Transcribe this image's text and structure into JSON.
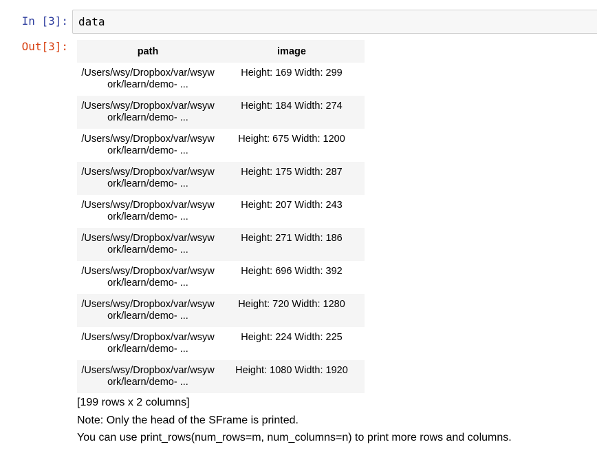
{
  "input_cell": {
    "prompt": "In [3]:",
    "code": "data"
  },
  "output_cell": {
    "prompt": "Out[3]:"
  },
  "table": {
    "headers": [
      "path",
      "image"
    ],
    "rows": [
      {
        "path": "/Users/wsy/Dropbox/var/wsywork/learn/demo- ...",
        "image": "Height: 169 Width: 299"
      },
      {
        "path": "/Users/wsy/Dropbox/var/wsywork/learn/demo- ...",
        "image": "Height: 184 Width: 274"
      },
      {
        "path": "/Users/wsy/Dropbox/var/wsywork/learn/demo- ...",
        "image": "Height: 675 Width: 1200"
      },
      {
        "path": "/Users/wsy/Dropbox/var/wsywork/learn/demo- ...",
        "image": "Height: 175 Width: 287"
      },
      {
        "path": "/Users/wsy/Dropbox/var/wsywork/learn/demo- ...",
        "image": "Height: 207 Width: 243"
      },
      {
        "path": "/Users/wsy/Dropbox/var/wsywork/learn/demo- ...",
        "image": "Height: 271 Width: 186"
      },
      {
        "path": "/Users/wsy/Dropbox/var/wsywork/learn/demo- ...",
        "image": "Height: 696 Width: 392"
      },
      {
        "path": "/Users/wsy/Dropbox/var/wsywork/learn/demo- ...",
        "image": "Height: 720 Width: 1280"
      },
      {
        "path": "/Users/wsy/Dropbox/var/wsywork/learn/demo- ...",
        "image": "Height: 224 Width: 225"
      },
      {
        "path": "/Users/wsy/Dropbox/var/wsywork/learn/demo- ...",
        "image": "Height: 1080 Width: 1920"
      }
    ]
  },
  "footer": {
    "row_count": "[199 rows x 2 columns]",
    "note": "Note: Only the head of the SFrame is printed.",
    "hint": "You can use print_rows(num_rows=m, num_columns=n) to print more rows and columns."
  },
  "colors": {
    "in_prompt": "#303f9f",
    "out_prompt": "#d84315",
    "input_background": "#f7f7f7",
    "row_shade": "#f5f5f5"
  }
}
